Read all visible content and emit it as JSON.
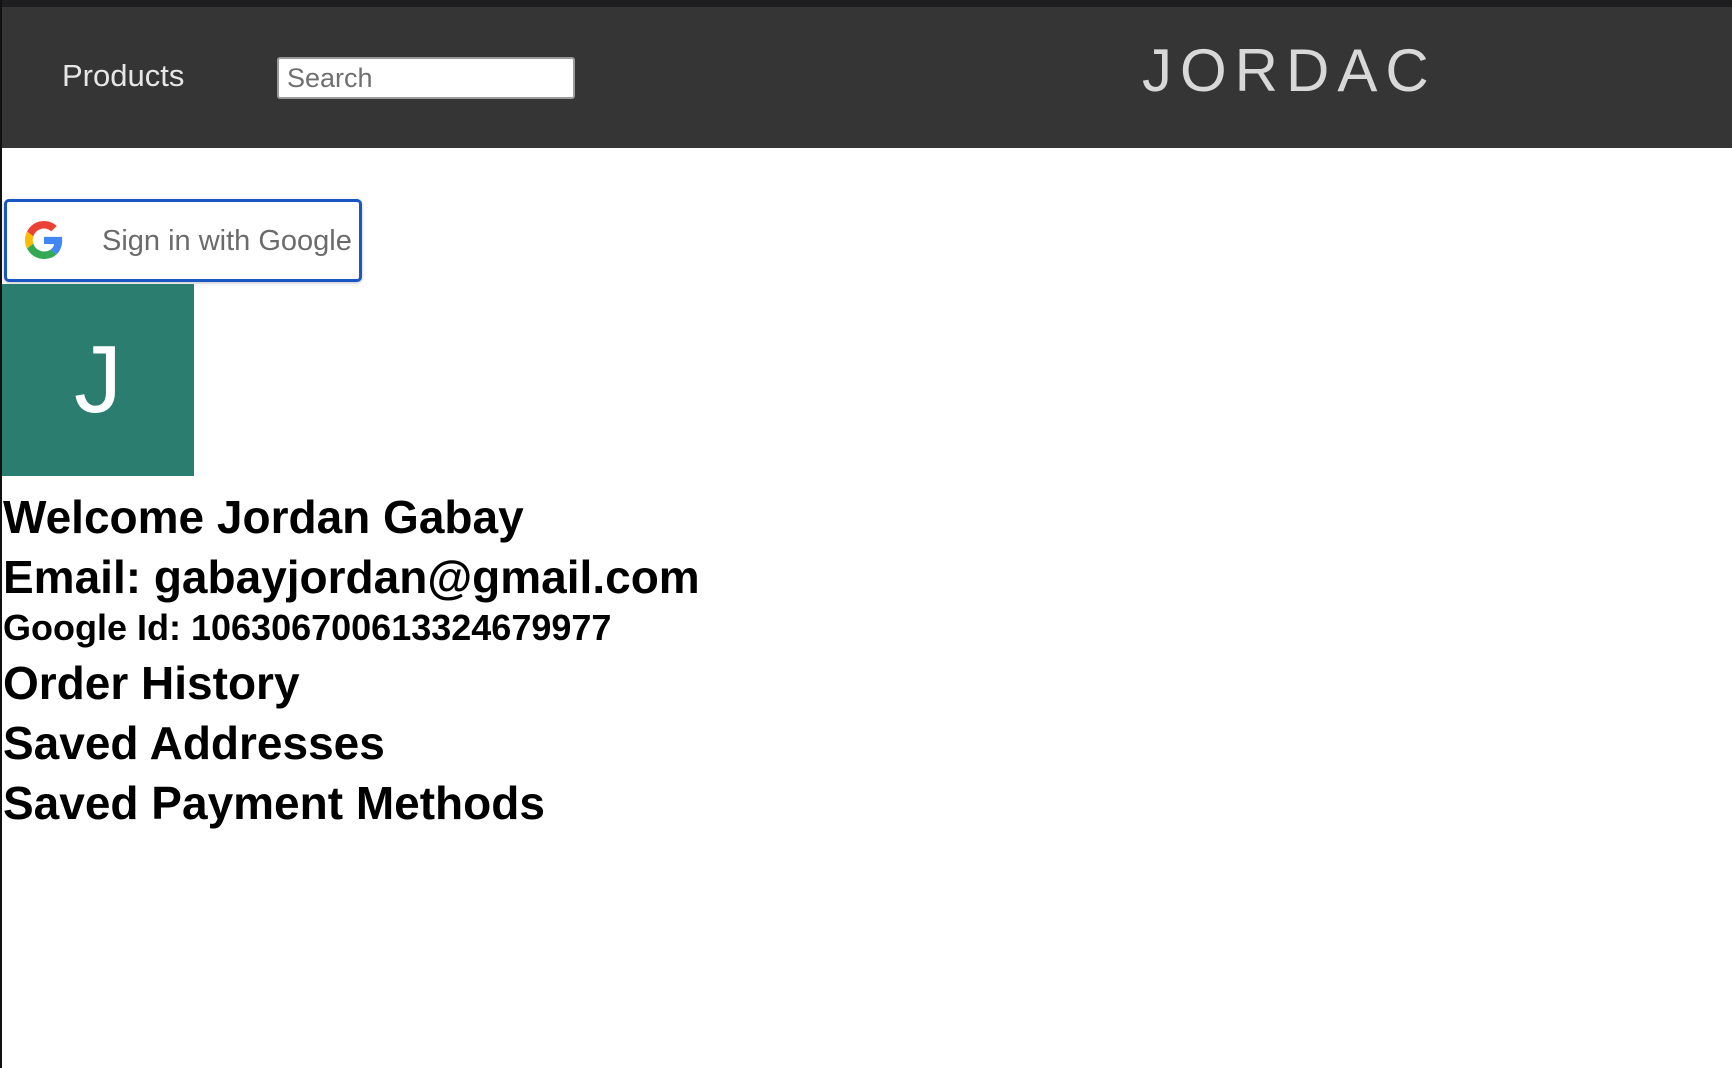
{
  "header": {
    "nav_products": "Products",
    "search_placeholder": "Search",
    "brand_name": "JORDAC"
  },
  "auth": {
    "google_button_label": "Sign in with Google"
  },
  "profile": {
    "avatar_initial": "J",
    "avatar_color": "#2a7d6f",
    "welcome": "Welcome Jordan Gabay",
    "email": "Email: gabayjordan@gmail.com",
    "google_id": "Google Id: 106306700613324679977"
  },
  "sections": {
    "order_history": "Order History",
    "saved_addresses": "Saved Addresses",
    "saved_payment_methods": "Saved Payment Methods"
  },
  "colors": {
    "navbar": "#353535",
    "google_border": "#1a57c5"
  }
}
